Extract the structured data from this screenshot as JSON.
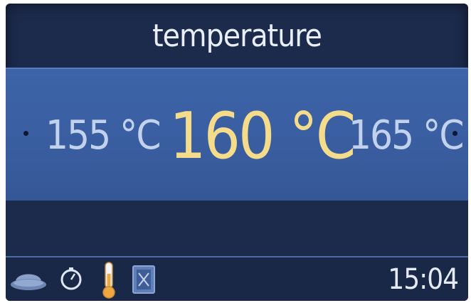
{
  "header": {
    "title": "temperature"
  },
  "selector": {
    "previous_value": "155 °C",
    "current_value": "160 °C",
    "next_value": "165 °C"
  },
  "status_bar": {
    "icons": [
      "dish-icon",
      "timer-icon",
      "thermometer-icon",
      "cleaning-icon"
    ],
    "time": "15:04"
  },
  "colors": {
    "background": "#1c2a4c",
    "band": "#3a5fa2",
    "current_value": "#f4dc8a",
    "side_values": "#c3d2ec",
    "thermometer_active": "#f0a640"
  }
}
